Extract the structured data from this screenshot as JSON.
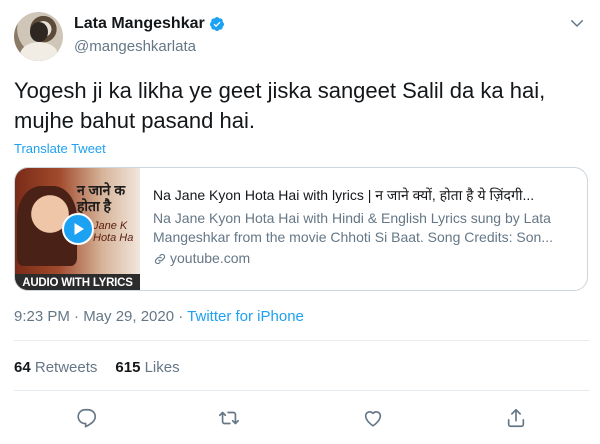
{
  "author": {
    "display_name": "Lata Mangeshkar",
    "handle": "@mangeshkarlata",
    "verified": true
  },
  "tweet": {
    "text": "Yogesh ji ka likha ye geet jiska sangeet Salil da ka hai, mujhe bahut pasand hai.",
    "translate_label": "Translate Tweet"
  },
  "card": {
    "thumbnail": {
      "hindi_title": "न जाने क\nहोता है",
      "english_title": "Jane K\nHota Ha",
      "banner": "AUDIO WITH LYRICS"
    },
    "title": "Na Jane Kyon Hota Hai with lyrics | न जाने क्यों, होता है ये ज़िंदगी...",
    "description": "Na Jane Kyon Hota Hai with Hindi & English Lyrics sung by Lata Mangeshkar from the movie Chhoti Si Baat. Song Credits: Son...",
    "domain": "youtube.com"
  },
  "meta": {
    "time_date": "9:23 PM · May 29, 2020 · ",
    "source": "Twitter for iPhone"
  },
  "stats": {
    "retweets_count": "64",
    "retweets_label": "Retweets",
    "likes_count": "615",
    "likes_label": "Likes"
  },
  "actions": [
    "reply-icon",
    "retweet-icon",
    "like-icon",
    "share-icon"
  ],
  "colors": {
    "accent": "#1da1f2",
    "text_primary": "#14171a",
    "text_secondary": "#657786",
    "border": "#ccd6dd"
  }
}
